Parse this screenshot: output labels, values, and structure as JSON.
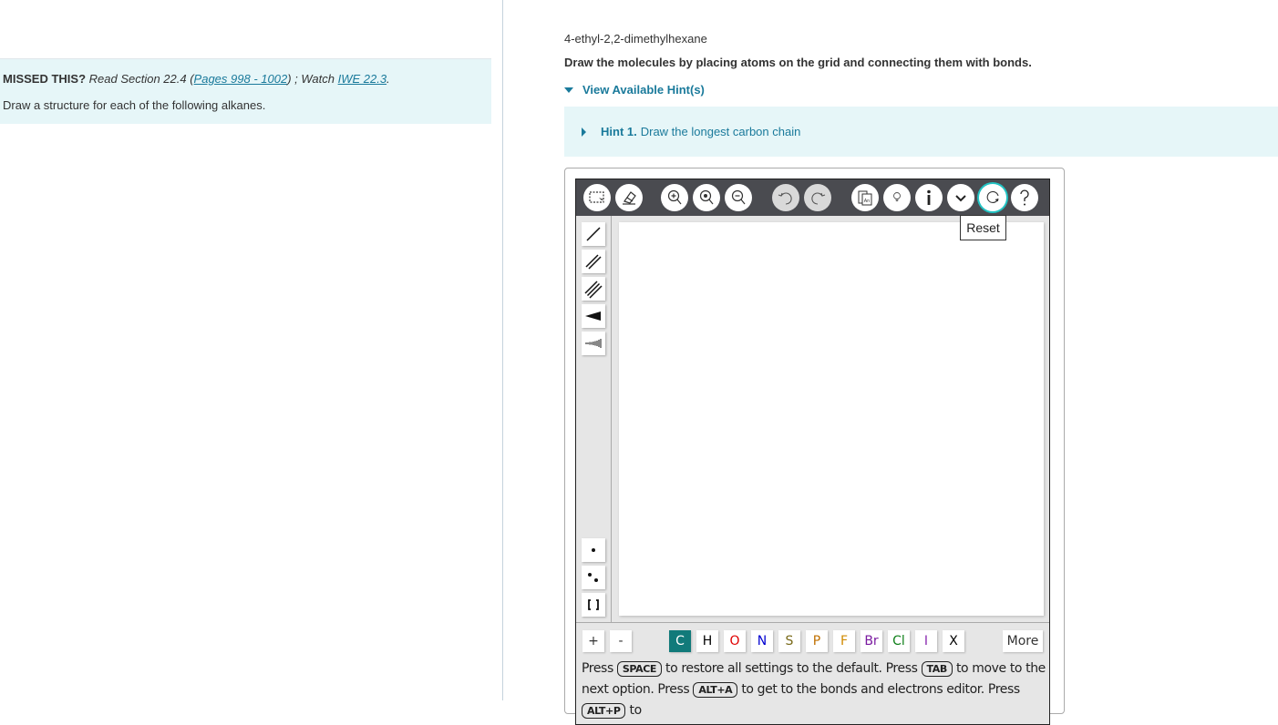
{
  "left": {
    "missed_label": "MISSED THIS?",
    "read_prefix": "Read Section 22.4 (",
    "pages_link": "Pages 998 - 1002",
    "watch_text": ") ; Watch ",
    "iwe_link": "IWE 22.3",
    "period": ".",
    "prompt": "Draw a structure for each of the following alkanes."
  },
  "right": {
    "molecule_name": "4-ethyl-2,2-dimethylhexane",
    "instructions": "Draw the molecules by placing atoms on the grid and connecting them with bonds.",
    "hints_toggle": "View Available Hint(s)",
    "hint_label": "Hint 1.",
    "hint_text": "Draw the longest carbon chain"
  },
  "editor": {
    "toolbar": [
      {
        "name": "select-tool",
        "icon": "marquee-select-icon"
      },
      {
        "name": "erase-tool",
        "icon": "eraser-icon"
      },
      {
        "name": "zoom-in",
        "icon": "zoom-in-icon"
      },
      {
        "name": "zoom-reset",
        "icon": "zoom-reset-icon"
      },
      {
        "name": "zoom-out",
        "icon": "zoom-out-icon"
      },
      {
        "name": "undo",
        "icon": "undo-icon"
      },
      {
        "name": "redo",
        "icon": "redo-icon"
      },
      {
        "name": "templates",
        "icon": "templates-icon"
      },
      {
        "name": "hint",
        "icon": "lightbulb-icon"
      },
      {
        "name": "info",
        "icon": "info-icon"
      },
      {
        "name": "more-options",
        "icon": "chevron-down-icon"
      },
      {
        "name": "reset",
        "icon": "reset-icon"
      },
      {
        "name": "help",
        "icon": "question-icon"
      }
    ],
    "tooltip": "Reset",
    "bond_tools": [
      "single-bond",
      "double-bond",
      "triple-bond",
      "wedge-bond",
      "hash-bond"
    ],
    "electron_tools": [
      "radical",
      "lone-pair",
      "bracket"
    ],
    "charge_buttons": [
      "+",
      "-"
    ],
    "atoms": [
      {
        "symbol": "C",
        "color": "#ffffff",
        "selected": true
      },
      {
        "symbol": "H",
        "color": "#000000"
      },
      {
        "symbol": "O",
        "color": "#e00000"
      },
      {
        "symbol": "N",
        "color": "#0000d0"
      },
      {
        "symbol": "S",
        "color": "#7a6a1a"
      },
      {
        "symbol": "P",
        "color": "#c07000"
      },
      {
        "symbol": "F",
        "color": "#d08a00"
      },
      {
        "symbol": "Br",
        "color": "#7a1aa0"
      },
      {
        "symbol": "Cl",
        "color": "#10801a"
      },
      {
        "symbol": "I",
        "color": "#8a2ab0"
      },
      {
        "symbol": "X",
        "color": "#000000"
      }
    ],
    "more_label": "More",
    "help": {
      "t1": "Press ",
      "k1": "SPACE",
      "t2": " to restore all settings to the default. Press ",
      "k2": "TAB",
      "t3": " to move to the next option. Press ",
      "k3": "ALT+A",
      "t4": " to get to the bonds and electrons editor. Press ",
      "k4": "ALT+P",
      "t5": " to"
    }
  }
}
